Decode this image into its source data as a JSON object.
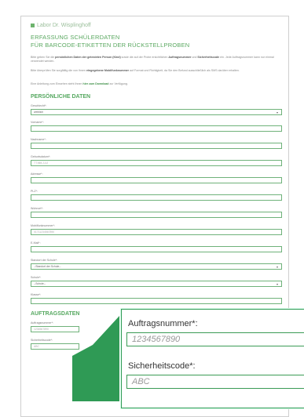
{
  "logo": {
    "text": "Labor Dr. Wisplinghoff"
  },
  "title": {
    "line1": "ERFASSUNG SCHÜLERDATEN",
    "line2": "FÜR BARCODE-ETIKETTEN DER RÜCKSTELLPROBEN"
  },
  "intro": {
    "p1_a": "Bitte geben Sie die ",
    "p1_b": "persönlichen Daten der getesteten Person (Kind)",
    "p1_c": " sowie die auf der Probe ersichtlichen ",
    "p1_d": "Auftragsnummer",
    "p1_e": " und ",
    "p1_f": "Sicherheitscode",
    "p1_g": " ein. Jede Auftragsnummer kann nur einmal verwendet werden.",
    "p2_a": "Bitte überprüfen Sie sorgfältig die von Ihnen ",
    "p2_b": "eingegebene Mobilfunknummer",
    "p2_c": " auf Format und Richtigkeit, da Sie den Befund ausschließlich als SMS darüber erhalten.",
    "p3_a": "Eine Anleitung zum Einsehen steht Ihnen ",
    "p3_b": "hier zum Download",
    "p3_c": " zur Verfügung."
  },
  "personal": {
    "heading": "PERSÖNLICHE DATEN",
    "gender_label": "Geschlecht*:",
    "gender_value": "weiblich",
    "firstname_label": "Vorname*:",
    "lastname_label": "Nachname*:",
    "birthdate_label": "Geburtsdatum*:",
    "birthdate_placeholder": "TT.MM.JJJJ",
    "address_label": "Adresse*:",
    "zip_label": "PLZ*:",
    "city_label": "Wohnort*:",
    "mobile_label": "Mobilfunknummer*:",
    "mobile_placeholder": "01711234567890",
    "email_label": "E-Mail*:",
    "school_location_label": "Standort der Schule*:",
    "school_location_value": "--Standort der Schule--",
    "school_label": "Schule*:",
    "school_value": "--Schule--",
    "class_label": "Klasse*:"
  },
  "order": {
    "heading": "AUFTRAGSDATEN",
    "order_label": "Auftragsnummer*:",
    "order_placeholder": "1234567890",
    "code_label": "Sicherheitscode*:",
    "code_placeholder": "ABC"
  },
  "zoom": {
    "order_label": "Auftragsnummer*:",
    "order_placeholder": "1234567890",
    "code_label": "Sicherheitscode*:",
    "code_placeholder": "ABC"
  },
  "colors": {
    "accent": "#56a860",
    "border": "#6fb27a",
    "arrow": "#1e8a4a"
  }
}
